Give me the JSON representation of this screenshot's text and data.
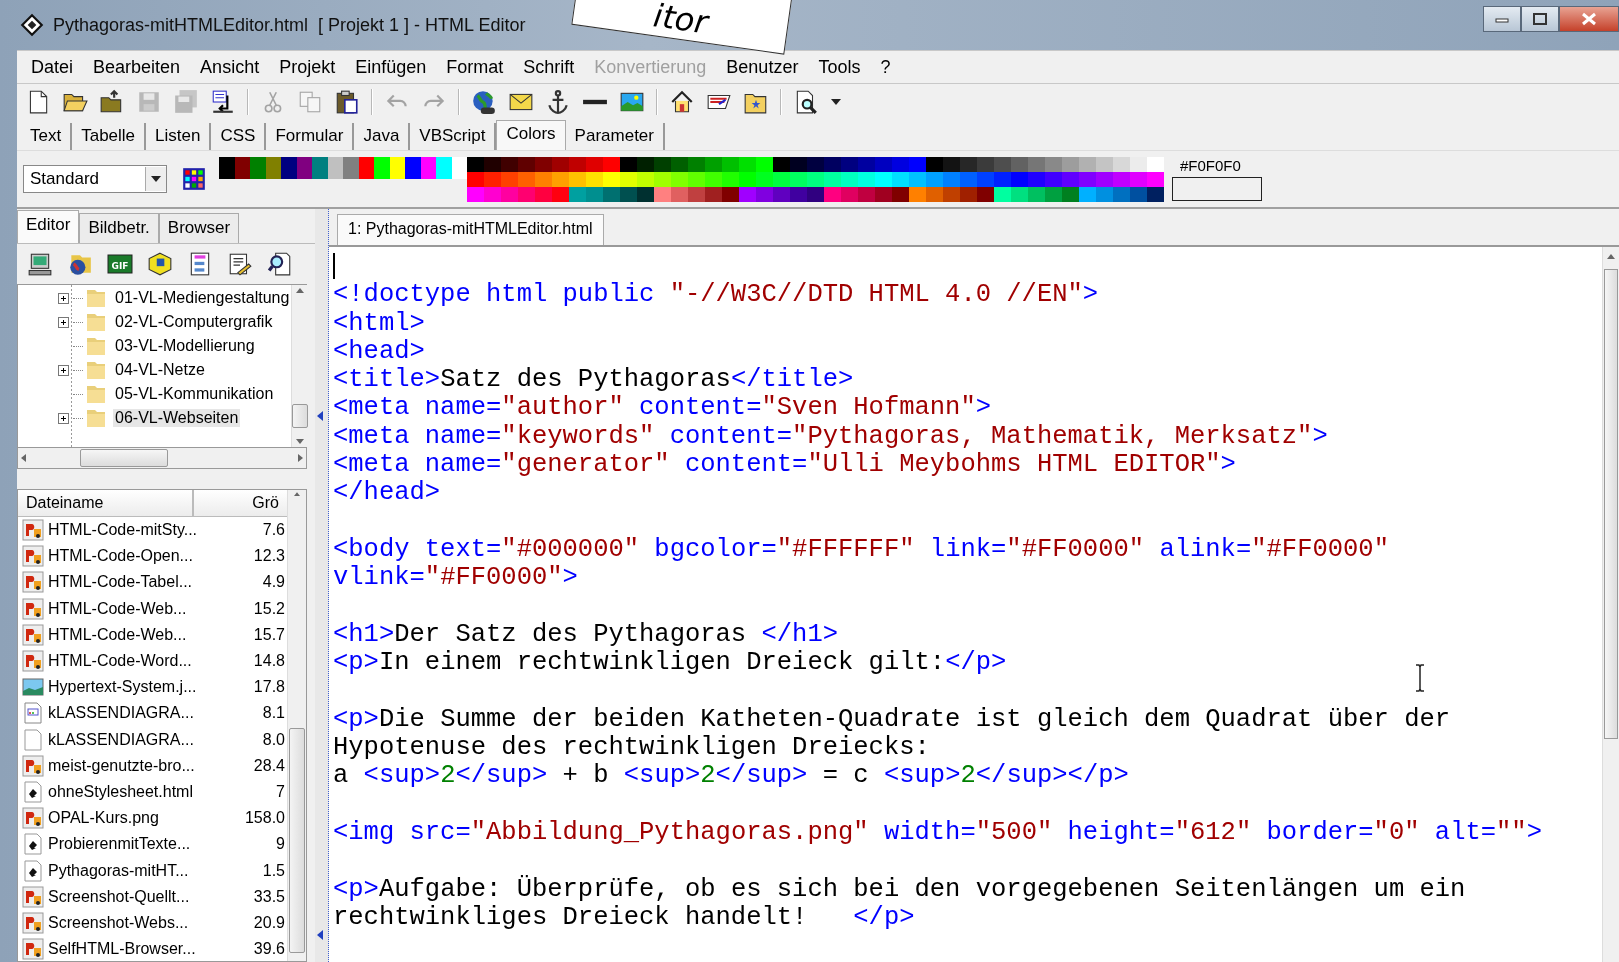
{
  "window": {
    "title": "Pythagoras-mitHTMLEditor.html  [ Projekt 1 ] - HTML Editor"
  },
  "callout": {
    "text": "itor"
  },
  "menu": [
    {
      "label": "Datei",
      "disabled": false
    },
    {
      "label": "Bearbeiten",
      "disabled": false
    },
    {
      "label": "Ansicht",
      "disabled": false
    },
    {
      "label": "Projekt",
      "disabled": false
    },
    {
      "label": "Einfügen",
      "disabled": false
    },
    {
      "label": "Format",
      "disabled": false
    },
    {
      "label": "Schrift",
      "disabled": false
    },
    {
      "label": "Konvertierung",
      "disabled": true
    },
    {
      "label": "Benutzer",
      "disabled": false
    },
    {
      "label": "Tools",
      "disabled": false
    },
    {
      "label": "?",
      "disabled": false
    }
  ],
  "toolbar": [
    {
      "kind": "new",
      "disabled": false
    },
    {
      "kind": "open",
      "disabled": false
    },
    {
      "kind": "folderup",
      "disabled": false
    },
    {
      "kind": "save",
      "disabled": true
    },
    {
      "kind": "saveall",
      "disabled": true
    },
    {
      "kind": "transfer",
      "disabled": false
    },
    {
      "kind": "separator"
    },
    {
      "kind": "cut",
      "disabled": true
    },
    {
      "kind": "copy",
      "disabled": true
    },
    {
      "kind": "paste",
      "disabled": false
    },
    {
      "kind": "separator"
    },
    {
      "kind": "undo",
      "disabled": true
    },
    {
      "kind": "redo",
      "disabled": true
    },
    {
      "kind": "separator"
    },
    {
      "kind": "globe",
      "disabled": false
    },
    {
      "kind": "mail",
      "disabled": false
    },
    {
      "kind": "anchor",
      "disabled": false
    },
    {
      "kind": "rule",
      "disabled": false
    },
    {
      "kind": "image",
      "disabled": false
    },
    {
      "kind": "separator"
    },
    {
      "kind": "home",
      "disabled": false
    },
    {
      "kind": "card",
      "disabled": false
    },
    {
      "kind": "folderstar",
      "disabled": false
    },
    {
      "kind": "separator"
    },
    {
      "kind": "preview",
      "disabled": false
    },
    {
      "kind": "caret",
      "disabled": false
    }
  ],
  "tabs": [
    {
      "label": "Text",
      "selected": false
    },
    {
      "label": "Tabelle",
      "selected": false
    },
    {
      "label": "Listen",
      "selected": false
    },
    {
      "label": "CSS",
      "selected": false
    },
    {
      "label": "Formular",
      "selected": false
    },
    {
      "label": "Java",
      "selected": false
    },
    {
      "label": "VBScript",
      "selected": false
    },
    {
      "label": "Colors",
      "selected": true
    },
    {
      "label": "Parameter",
      "selected": false
    }
  ],
  "palette": {
    "style": "Standard",
    "basic_colors": [
      {
        "color": "#000000"
      },
      {
        "color": "#800000"
      },
      {
        "color": "#008000"
      },
      {
        "color": "#808000"
      },
      {
        "color": "#000080"
      },
      {
        "color": "#800080"
      },
      {
        "color": "#008080"
      },
      {
        "color": "#c0c0c0"
      },
      {
        "color": "#808080"
      },
      {
        "color": "#ff0000"
      },
      {
        "color": "#00ff00"
      },
      {
        "color": "#ffff00"
      },
      {
        "color": "#0000ff"
      },
      {
        "color": "#ff00ff"
      },
      {
        "color": "#00ffff"
      },
      {
        "color": "#ffffff"
      }
    ],
    "rows": [
      [
        {
          "color": "#000000"
        },
        {
          "color": "#200000"
        },
        {
          "color": "#400000"
        },
        {
          "color": "#600000"
        },
        {
          "color": "#800000"
        },
        {
          "color": "#a00000"
        },
        {
          "color": "#c00000"
        },
        {
          "color": "#e00000"
        },
        {
          "color": "#ff0000"
        },
        {
          "color": "#000000"
        },
        {
          "color": "#002000"
        },
        {
          "color": "#004000"
        },
        {
          "color": "#006000"
        },
        {
          "color": "#008000"
        },
        {
          "color": "#00a000"
        },
        {
          "color": "#00c000"
        },
        {
          "color": "#00e000"
        },
        {
          "color": "#00ff00"
        },
        {
          "color": "#000000"
        },
        {
          "color": "#000020"
        },
        {
          "color": "#000040"
        },
        {
          "color": "#000060"
        },
        {
          "color": "#000080"
        },
        {
          "color": "#0000a0"
        },
        {
          "color": "#0000c0"
        },
        {
          "color": "#0000e0"
        },
        {
          "color": "#0000ff"
        },
        {
          "color": "#000000"
        },
        {
          "color": "#131313"
        },
        {
          "color": "#272727"
        },
        {
          "color": "#3b3b3b"
        },
        {
          "color": "#4e4e4e"
        },
        {
          "color": "#626262"
        },
        {
          "color": "#767676"
        },
        {
          "color": "#898989"
        },
        {
          "color": "#9d9d9d"
        },
        {
          "color": "#b1b1b1"
        },
        {
          "color": "#c4c4c4"
        },
        {
          "color": "#d8d8d8"
        },
        {
          "color": "#ececec"
        },
        {
          "color": "#ffffff"
        }
      ],
      [
        {
          "color": "#ff0000"
        },
        {
          "color": "#ff2000"
        },
        {
          "color": "#ff4000"
        },
        {
          "color": "#ff6000"
        },
        {
          "color": "#ff8000"
        },
        {
          "color": "#ffa000"
        },
        {
          "color": "#ffc000"
        },
        {
          "color": "#ffe000"
        },
        {
          "color": "#ffff00"
        },
        {
          "color": "#e0ff00"
        },
        {
          "color": "#c0ff00"
        },
        {
          "color": "#a0ff00"
        },
        {
          "color": "#80ff00"
        },
        {
          "color": "#60ff00"
        },
        {
          "color": "#40ff00"
        },
        {
          "color": "#20ff00"
        },
        {
          "color": "#00ff00"
        },
        {
          "color": "#00ff20"
        },
        {
          "color": "#00ff40"
        },
        {
          "color": "#00ff60"
        },
        {
          "color": "#00ff80"
        },
        {
          "color": "#00ffa0"
        },
        {
          "color": "#00ffc0"
        },
        {
          "color": "#00ffe0"
        },
        {
          "color": "#00ffff"
        },
        {
          "color": "#00e0ff"
        },
        {
          "color": "#00c0ff"
        },
        {
          "color": "#00a0ff"
        },
        {
          "color": "#0080ff"
        },
        {
          "color": "#0060ff"
        },
        {
          "color": "#0040ff"
        },
        {
          "color": "#0020ff"
        },
        {
          "color": "#0000ff"
        },
        {
          "color": "#2000ff"
        },
        {
          "color": "#4000ff"
        },
        {
          "color": "#6000ff"
        },
        {
          "color": "#8000ff"
        },
        {
          "color": "#a000ff"
        },
        {
          "color": "#c000ff"
        },
        {
          "color": "#e000ff"
        },
        {
          "color": "#ff00ff"
        }
      ],
      [
        {
          "color": "#ff00ff"
        },
        {
          "color": "#ff00d0"
        },
        {
          "color": "#ff00a0"
        },
        {
          "color": "#ff0070"
        },
        {
          "color": "#ff0040"
        },
        {
          "color": "#ff0010"
        },
        {
          "color": "#00a0a0"
        },
        {
          "color": "#008f8f"
        },
        {
          "color": "#007070"
        },
        {
          "color": "#005050"
        },
        {
          "color": "#003030"
        },
        {
          "color": "#ff8080"
        },
        {
          "color": "#e06060"
        },
        {
          "color": "#c04040"
        },
        {
          "color": "#a02020"
        },
        {
          "color": "#800000"
        },
        {
          "color": "#a000ff"
        },
        {
          "color": "#8000e0"
        },
        {
          "color": "#6000c0"
        },
        {
          "color": "#4000a0"
        },
        {
          "color": "#300080"
        },
        {
          "color": "#ff0080"
        },
        {
          "color": "#e00060"
        },
        {
          "color": "#c00040"
        },
        {
          "color": "#a00020"
        },
        {
          "color": "#800000"
        },
        {
          "color": "#ff8000"
        },
        {
          "color": "#e06000"
        },
        {
          "color": "#c04000"
        },
        {
          "color": "#a02000"
        },
        {
          "color": "#800000"
        },
        {
          "color": "#00ffa0"
        },
        {
          "color": "#00e080"
        },
        {
          "color": "#00c060"
        },
        {
          "color": "#00a040"
        },
        {
          "color": "#008020"
        },
        {
          "color": "#00b0ff"
        },
        {
          "color": "#0090e0"
        },
        {
          "color": "#0070c0"
        },
        {
          "color": "#0050a0"
        },
        {
          "color": "#002060"
        }
      ]
    ],
    "current_color": {
      "label": "#F0F0F0",
      "color": "#f0f0f0"
    }
  },
  "side_panel": {
    "tabs": [
      {
        "label": "Editor",
        "selected": true
      },
      {
        "label": "Bildbetr.",
        "selected": false
      },
      {
        "label": "Browser",
        "selected": false
      }
    ],
    "tools": [
      {
        "kind": "monitor"
      },
      {
        "kind": "globefolder"
      },
      {
        "kind": "gif",
        "label": "GIF"
      },
      {
        "kind": "cube"
      },
      {
        "kind": "form"
      },
      {
        "kind": "editdoc"
      },
      {
        "kind": "searchdoc"
      }
    ],
    "tree": [
      {
        "label": "01-VL-Mediengestaltung",
        "expander": true,
        "selected": false
      },
      {
        "label": "02-VL-Computergrafik",
        "expander": true,
        "selected": false
      },
      {
        "label": "03-VL-Modellierung",
        "expander": false,
        "selected": false
      },
      {
        "label": "04-VL-Netze",
        "expander": true,
        "selected": false
      },
      {
        "label": "05-VL-Kommunikation",
        "expander": false,
        "selected": false
      },
      {
        "label": "06-VL-Webseiten",
        "expander": true,
        "selected": true
      }
    ],
    "files": {
      "columns": [
        "Dateiname",
        "Grö"
      ],
      "rows": [
        {
          "kind": "png",
          "name": "HTML-Code-mitSty...",
          "size": "7.6"
        },
        {
          "kind": "png",
          "name": "HTML-Code-Open...",
          "size": "12.3"
        },
        {
          "kind": "png",
          "name": "HTML-Code-Tabel...",
          "size": "4.9"
        },
        {
          "kind": "png",
          "name": "HTML-Code-Web...",
          "size": "15.2"
        },
        {
          "kind": "png",
          "name": "HTML-Code-Web...",
          "size": "15.7"
        },
        {
          "kind": "png",
          "name": "HTML-Code-Word...",
          "size": "14.8"
        },
        {
          "kind": "jpg",
          "name": "Hypertext-System.j...",
          "size": "17.8"
        },
        {
          "kind": "diagram",
          "name": "kLASSENDIAGRA...",
          "size": "8.1"
        },
        {
          "kind": "blank",
          "name": "kLASSENDIAGRA...",
          "size": "8.0"
        },
        {
          "kind": "png",
          "name": "meist-genutzte-bro...",
          "size": "28.4"
        },
        {
          "kind": "html",
          "name": "ohneStylesheet.html",
          "size": "7"
        },
        {
          "kind": "png",
          "name": "OPAL-Kurs.png",
          "size": "158.0"
        },
        {
          "kind": "html",
          "name": "ProbierenmitTexte...",
          "size": "9"
        },
        {
          "kind": "html",
          "name": "Pythagoras-mitHT...",
          "size": "1.5"
        },
        {
          "kind": "png",
          "name": "Screenshot-Quellt...",
          "size": "33.5"
        },
        {
          "kind": "png",
          "name": "Screenshot-Webs...",
          "size": "20.9"
        },
        {
          "kind": "png",
          "name": "SelfHTML-Browser...",
          "size": "39.6"
        }
      ]
    }
  },
  "editor": {
    "tab": "1: Pythagoras-mitHTMLEditor.html",
    "lines": [
      {
        "kind": "caret"
      },
      {
        "kind": "code",
        "segments": [
          {
            "kind": "tag",
            "text": "<!doctype html public "
          },
          {
            "kind": "string",
            "text": "\"-//W3C//DTD HTML 4.0 //EN\""
          },
          {
            "kind": "tag",
            "text": ">"
          }
        ]
      },
      {
        "kind": "code",
        "segments": [
          {
            "kind": "tag",
            "text": "<html>"
          }
        ]
      },
      {
        "kind": "code",
        "segments": [
          {
            "kind": "tag",
            "text": "<head>"
          }
        ]
      },
      {
        "kind": "code",
        "segments": [
          {
            "kind": "tag",
            "text": "<title>"
          },
          {
            "kind": "text",
            "text": "Satz des Pythagoras"
          },
          {
            "kind": "tag",
            "text": "</title>"
          }
        ]
      },
      {
        "kind": "code",
        "segments": [
          {
            "kind": "tag",
            "text": "<meta name="
          },
          {
            "kind": "string",
            "text": "\"author\""
          },
          {
            "kind": "tag",
            "text": " content="
          },
          {
            "kind": "string",
            "text": "\"Sven Hofmann\""
          },
          {
            "kind": "tag",
            "text": ">"
          }
        ]
      },
      {
        "kind": "code",
        "segments": [
          {
            "kind": "tag",
            "text": "<meta name="
          },
          {
            "kind": "string",
            "text": "\"keywords\""
          },
          {
            "kind": "tag",
            "text": " content="
          },
          {
            "kind": "string",
            "text": "\"Pythagoras, Mathematik, Merksatz\""
          },
          {
            "kind": "tag",
            "text": ">"
          }
        ]
      },
      {
        "kind": "code",
        "segments": [
          {
            "kind": "tag",
            "text": "<meta name="
          },
          {
            "kind": "string",
            "text": "\"generator\""
          },
          {
            "kind": "tag",
            "text": " content="
          },
          {
            "kind": "string",
            "text": "\"Ulli Meybohms HTML EDITOR\""
          },
          {
            "kind": "tag",
            "text": ">"
          }
        ]
      },
      {
        "kind": "code",
        "segments": [
          {
            "kind": "tag",
            "text": "</head>"
          }
        ]
      },
      {
        "kind": "blank"
      },
      {
        "kind": "code",
        "segments": [
          {
            "kind": "tag",
            "text": "<body text="
          },
          {
            "kind": "string",
            "text": "\"#000000\""
          },
          {
            "kind": "tag",
            "text": " bgcolor="
          },
          {
            "kind": "string",
            "text": "\"#FFFFFF\""
          },
          {
            "kind": "tag",
            "text": " link="
          },
          {
            "kind": "string",
            "text": "\"#FF0000\""
          },
          {
            "kind": "tag",
            "text": " alink="
          },
          {
            "kind": "string",
            "text": "\"#FF0000\""
          }
        ]
      },
      {
        "kind": "code",
        "segments": [
          {
            "kind": "tag",
            "text": "vlink="
          },
          {
            "kind": "string",
            "text": "\"#FF0000\""
          },
          {
            "kind": "tag",
            "text": ">"
          }
        ]
      },
      {
        "kind": "blank"
      },
      {
        "kind": "code",
        "segments": [
          {
            "kind": "tag",
            "text": "<h1>"
          },
          {
            "kind": "text",
            "text": "Der Satz des Pythagoras "
          },
          {
            "kind": "tag",
            "text": "</h1>"
          }
        ]
      },
      {
        "kind": "code",
        "segments": [
          {
            "kind": "tag",
            "text": "<p>"
          },
          {
            "kind": "text",
            "text": "In einem rechtwinkligen Dreieck gilt:"
          },
          {
            "kind": "tag",
            "text": "</p>"
          }
        ]
      },
      {
        "kind": "blank"
      },
      {
        "kind": "code",
        "segments": [
          {
            "kind": "tag",
            "text": "<p>"
          },
          {
            "kind": "text",
            "text": "Die Summe der beiden Katheten-Quadrate ist gleich dem Quadrat über der"
          }
        ]
      },
      {
        "kind": "code",
        "segments": [
          {
            "kind": "text",
            "text": "Hypotenuse des rechtwinkligen Dreiecks:"
          }
        ]
      },
      {
        "kind": "code",
        "segments": [
          {
            "kind": "text",
            "text": "a "
          },
          {
            "kind": "tag",
            "text": "<sup>"
          },
          {
            "kind": "number",
            "text": "2"
          },
          {
            "kind": "tag",
            "text": "</sup>"
          },
          {
            "kind": "text",
            "text": " + b "
          },
          {
            "kind": "tag",
            "text": "<sup>"
          },
          {
            "kind": "number",
            "text": "2"
          },
          {
            "kind": "tag",
            "text": "</sup>"
          },
          {
            "kind": "text",
            "text": " = c "
          },
          {
            "kind": "tag",
            "text": "<sup>"
          },
          {
            "kind": "number",
            "text": "2"
          },
          {
            "kind": "tag",
            "text": "</sup></p>"
          }
        ]
      },
      {
        "kind": "blank"
      },
      {
        "kind": "code",
        "segments": [
          {
            "kind": "tag",
            "text": "<img src="
          },
          {
            "kind": "string",
            "text": "\"Abbildung_Pythagoras.png\""
          },
          {
            "kind": "tag",
            "text": " width="
          },
          {
            "kind": "string",
            "text": "\"500\""
          },
          {
            "kind": "tag",
            "text": " height="
          },
          {
            "kind": "string",
            "text": "\"612\""
          },
          {
            "kind": "tag",
            "text": " border="
          },
          {
            "kind": "string",
            "text": "\"0\""
          },
          {
            "kind": "tag",
            "text": " alt="
          },
          {
            "kind": "string",
            "text": "\"\""
          },
          {
            "kind": "tag",
            "text": ">"
          }
        ]
      },
      {
        "kind": "blank"
      },
      {
        "kind": "code",
        "segments": [
          {
            "kind": "tag",
            "text": "<p>"
          },
          {
            "kind": "text",
            "text": "Aufgabe: Überprüfe, ob es sich bei den vorgegebenen Seitenlängen um ein"
          }
        ]
      },
      {
        "kind": "code",
        "segments": [
          {
            "kind": "text",
            "text": "rechtwinkliges Dreieck handelt!   "
          },
          {
            "kind": "tag",
            "text": "</p>"
          }
        ]
      }
    ]
  }
}
